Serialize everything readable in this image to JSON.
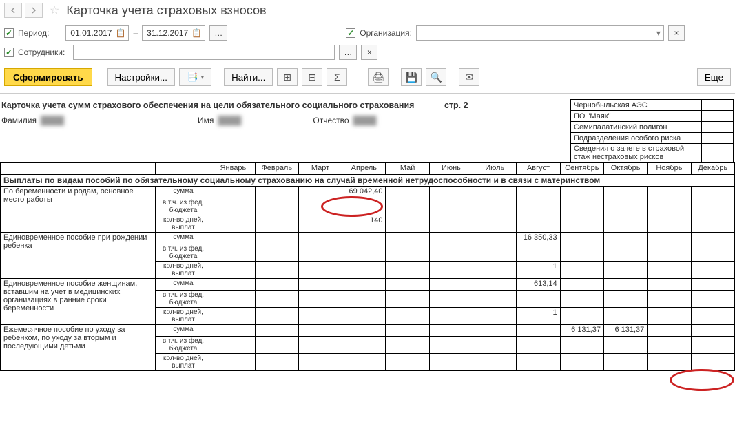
{
  "header": {
    "page_title": "Карточка учета страховых взносов"
  },
  "filters": {
    "period_label": "Период:",
    "date_from": "01.01.2017",
    "date_to": "31.12.2017",
    "dash": "–",
    "org_label": "Организация:",
    "org_value": "",
    "emp_label": "Сотрудники:",
    "emp_value": ""
  },
  "toolbar": {
    "form_btn": "Сформировать",
    "settings_btn": "Настройки...",
    "find_btn": "Найти...",
    "more_btn": "Еще"
  },
  "report": {
    "title": "Карточка учета сумм страхового обеспечения на цели обязательного социального страхования",
    "page_no_label": "стр. 2",
    "surname_label": "Фамилия",
    "name_label": "Имя",
    "patronymic_label": "Отчество",
    "surname_val": "████",
    "name_val": "████",
    "patronymic_val": "████",
    "info_rows": [
      "Чернобыльская АЭС",
      "ПО \"Маяк\"",
      "Семипалатинский полигон",
      "Подразделения особого риска",
      "Сведения о зачете в страховой стаж нестраховых рисков"
    ],
    "months": [
      "Январь",
      "Февраль",
      "Март",
      "Апрель",
      "Май",
      "Июнь",
      "Июль",
      "Август",
      "Сентябрь",
      "Октябрь",
      "Ноябрь",
      "Декабрь"
    ],
    "section_title": "Выплаты по видам пособий по обязательному социальному страхованию на случай временной нетрудоспособности и в связи с материнством",
    "sub_labels": {
      "sum": "сумма",
      "fed": "в т.ч. из фед. бюджета",
      "days": "кол-во дней, выплат"
    },
    "groups": [
      {
        "label": "По беременности и родам, основное место работы",
        "rows": {
          "sum": [
            "",
            "",
            "",
            "69 042,40",
            "",
            "",
            "",
            "",
            "",
            "",
            "",
            ""
          ],
          "fed": [
            "",
            "",
            "",
            "",
            "",
            "",
            "",
            "",
            "",
            "",
            "",
            ""
          ],
          "days": [
            "",
            "",
            "",
            "140",
            "",
            "",
            "",
            "",
            "",
            "",
            "",
            ""
          ]
        }
      },
      {
        "label": "Единовременное пособие при рождении ребенка",
        "rows": {
          "sum": [
            "",
            "",
            "",
            "",
            "",
            "",
            "",
            "16 350,33",
            "",
            "",
            "",
            ""
          ],
          "fed": [
            "",
            "",
            "",
            "",
            "",
            "",
            "",
            "",
            "",
            "",
            "",
            ""
          ],
          "days": [
            "",
            "",
            "",
            "",
            "",
            "",
            "",
            "1",
            "",
            "",
            "",
            ""
          ]
        }
      },
      {
        "label": "Единовременное пособие женщинам, вставшим на учет в медицинских организациях в ранние сроки беременности",
        "rows": {
          "sum": [
            "",
            "",
            "",
            "",
            "",
            "",
            "",
            "613,14",
            "",
            "",
            "",
            ""
          ],
          "fed": [
            "",
            "",
            "",
            "",
            "",
            "",
            "",
            "",
            "",
            "",
            "",
            ""
          ],
          "days": [
            "",
            "",
            "",
            "",
            "",
            "",
            "",
            "1",
            "",
            "",
            "",
            ""
          ]
        }
      },
      {
        "label": "Ежемесячное пособие по уходу за ребенком, по уходу за вторым и последующими детьми",
        "rows": {
          "sum": [
            "",
            "",
            "",
            "",
            "",
            "",
            "",
            "",
            "6 131,37",
            "6 131,37",
            "",
            ""
          ],
          "fed": [
            "",
            "",
            "",
            "",
            "",
            "",
            "",
            "",
            "",
            "",
            "",
            ""
          ],
          "days": [
            "",
            "",
            "",
            "",
            "",
            "",
            "",
            "",
            "",
            "",
            "",
            ""
          ]
        }
      }
    ]
  }
}
